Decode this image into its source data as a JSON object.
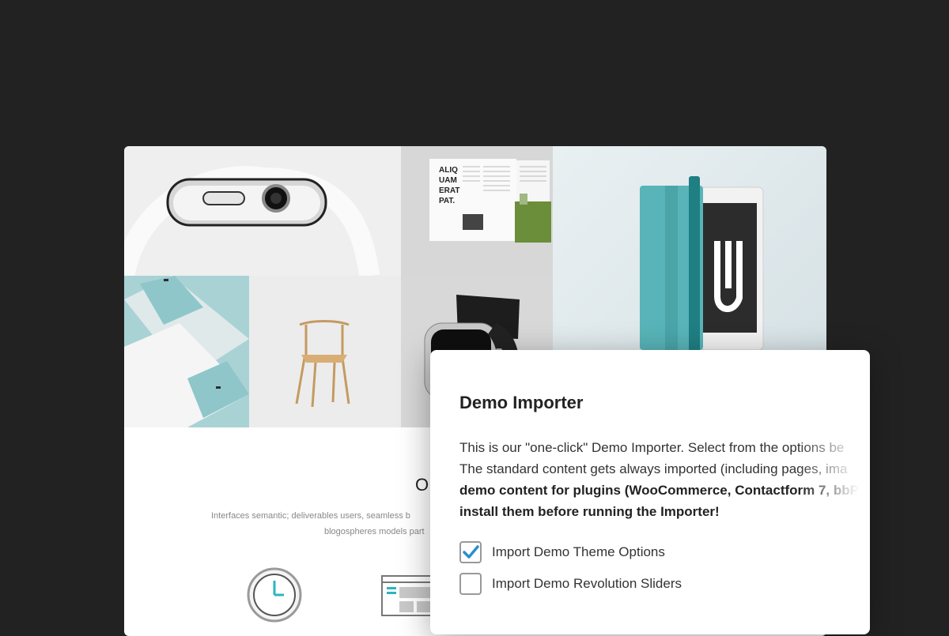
{
  "site": {
    "heading": "O",
    "description_line1": "Interfaces semantic; deliverables users, seamless b",
    "description_line2": "blogospheres models part",
    "magazine_headline": [
      "ALIQ",
      "UAM",
      "ERAT",
      "PAT."
    ],
    "portfolio_tiles": [
      "apple-watch-white",
      "magazine-spread",
      "ipad-teal-cover",
      "business-cards",
      "wooden-chair",
      "apple-watch-black"
    ]
  },
  "modal": {
    "title": "Demo Importer",
    "line1": "This is our \"one-click\" Demo Importer. Select from the options be",
    "line2": "The standard content gets always imported (including pages, ima",
    "line3": "demo content for plugins (WooCommerce, Contactform 7, bbPr",
    "line4": "install them before running the Importer!",
    "options": [
      {
        "label": "Import Demo Theme Options",
        "checked": true
      },
      {
        "label": "Import Demo Revolution Sliders",
        "checked": false
      }
    ]
  },
  "colors": {
    "background": "#222222",
    "accent": "#2b8ecc",
    "card_teal": "#a9d2d5"
  },
  "icons": [
    "clock-icon",
    "browser-layout-icon",
    "checkmark-icon"
  ]
}
